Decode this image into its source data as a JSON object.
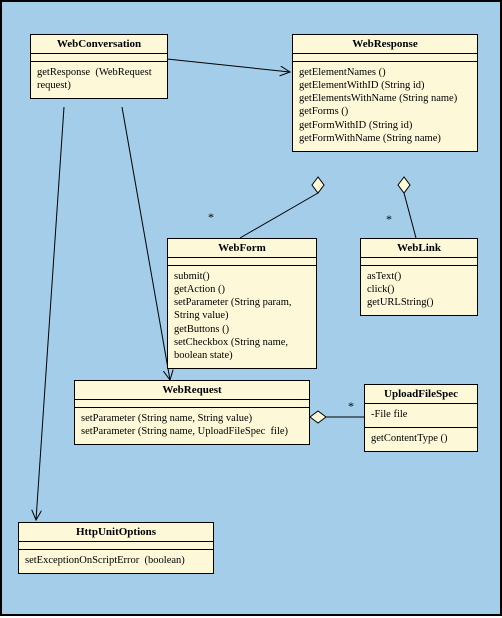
{
  "classes": {
    "WebConversation": {
      "name": "WebConversation",
      "ops": [
        "getResponse  (WebRequest request)"
      ]
    },
    "WebResponse": {
      "name": "WebResponse",
      "ops": [
        "getElementNames ()",
        "getElementWithID (String id)",
        "getElementsWithName (String name)",
        "getForms ()",
        "getFormWithID (String id)",
        "getFormWithName (String name)"
      ]
    },
    "WebForm": {
      "name": "WebForm",
      "ops": [
        "submit()",
        "getAction ()",
        "setParameter (String param, String value)",
        "getButtons ()",
        "setCheckbox (String name, boolean state)"
      ]
    },
    "WebLink": {
      "name": "WebLink",
      "ops": [
        "asText()",
        "click()",
        "getURLString()"
      ]
    },
    "WebRequest": {
      "name": "WebRequest",
      "ops": [
        "setParameter (String name, String value)",
        "setParameter (String name, UploadFileSpec  file)"
      ]
    },
    "UploadFileSpec": {
      "name": "UploadFileSpec",
      "attrs": [
        "-File file"
      ],
      "ops": [
        "getContentType ()"
      ]
    },
    "HttpUnitOptions": {
      "name": "HttpUnitOptions",
      "ops": [
        "setExceptionOnScriptError  (boolean)"
      ]
    }
  },
  "multiplicities": {
    "form": "*",
    "link": "*",
    "upload": "*"
  },
  "chart_data": {
    "type": "table",
    "title": "UML Class Diagram",
    "nodes": [
      {
        "id": "WebConversation",
        "operations": [
          "getResponse(WebRequest request)"
        ]
      },
      {
        "id": "WebResponse",
        "operations": [
          "getElementNames()",
          "getElementWithID(String id)",
          "getElementsWithName(String name)",
          "getForms()",
          "getFormWithID(String id)",
          "getFormWithName(String name)"
        ]
      },
      {
        "id": "WebForm",
        "operations": [
          "submit()",
          "getAction()",
          "setParameter(String param, String value)",
          "getButtons()",
          "setCheckbox(String name, boolean state)"
        ]
      },
      {
        "id": "WebLink",
        "operations": [
          "asText()",
          "click()",
          "getURLString()"
        ]
      },
      {
        "id": "WebRequest",
        "operations": [
          "setParameter(String name, String value)",
          "setParameter(String name, UploadFileSpec file)"
        ]
      },
      {
        "id": "UploadFileSpec",
        "attributes": [
          "-File file"
        ],
        "operations": [
          "getContentType()"
        ]
      },
      {
        "id": "HttpUnitOptions",
        "operations": [
          "setExceptionOnScriptError(boolean)"
        ]
      }
    ],
    "edges": [
      {
        "from": "WebConversation",
        "to": "WebResponse",
        "type": "association",
        "arrow": "open"
      },
      {
        "from": "WebConversation",
        "to": "WebRequest",
        "type": "association",
        "arrow": "open"
      },
      {
        "from": "WebConversation",
        "to": "HttpUnitOptions",
        "type": "association",
        "arrow": "open"
      },
      {
        "from": "WebResponse",
        "to": "WebForm",
        "type": "aggregation",
        "multiplicity": "*"
      },
      {
        "from": "WebResponse",
        "to": "WebLink",
        "type": "aggregation",
        "multiplicity": "*"
      },
      {
        "from": "WebRequest",
        "to": "UploadFileSpec",
        "type": "aggregation",
        "multiplicity": "*"
      }
    ]
  }
}
